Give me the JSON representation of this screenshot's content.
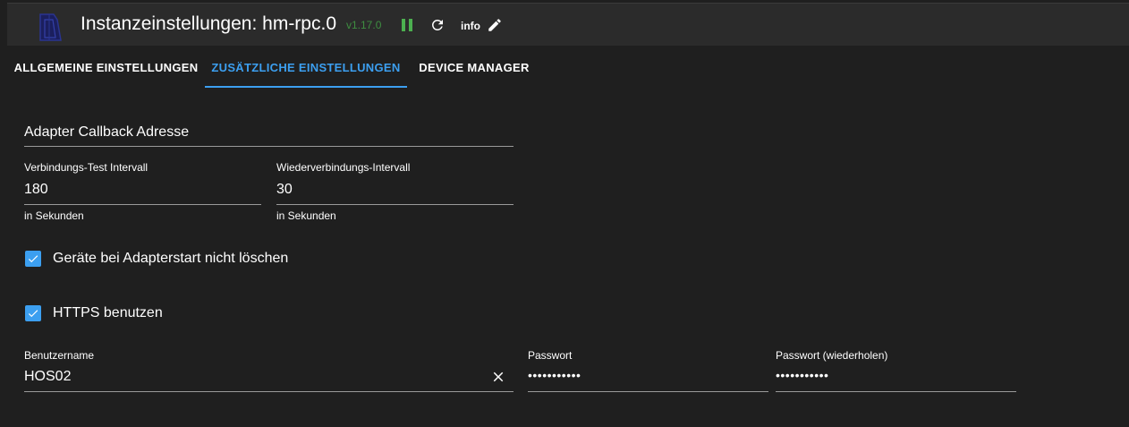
{
  "header": {
    "title": "Instanzeinstellungen: hm-rpc.0",
    "version": "v1.17.0",
    "info_label": "info",
    "icons": [
      "logo-icon",
      "pause-icon",
      "reload-icon",
      "edit-icon"
    ],
    "colors": {
      "version": "#3e8e41",
      "pause": "#4caf50",
      "accent": "#3c9ff0"
    }
  },
  "tabs": [
    {
      "label": "Allgemeine Einstellungen",
      "active": false
    },
    {
      "label": "Zusätzliche Einstellungen",
      "active": true
    },
    {
      "label": "Device Manager",
      "active": false
    }
  ],
  "form": {
    "callback_address": {
      "label": "Adapter Callback Adresse",
      "value": ""
    },
    "check_interval": {
      "label": "Verbindungs-Test Intervall",
      "value": "180",
      "helper": "in Sekunden"
    },
    "reconnect_interval": {
      "label": "Wiederverbindungs-Intervall",
      "value": "30",
      "helper": "in Sekunden"
    },
    "dont_delete_devices": {
      "label": "Geräte bei Adapterstart nicht löschen",
      "checked": true
    },
    "use_https": {
      "label": "HTTPS benutzen",
      "checked": true
    },
    "username": {
      "label": "Benutzername",
      "value": "HOS02"
    },
    "password": {
      "label": "Passwort",
      "value": "•••••••••••"
    },
    "password_repeat": {
      "label": "Passwort (wiederholen)",
      "value": "•••••••••••"
    }
  }
}
